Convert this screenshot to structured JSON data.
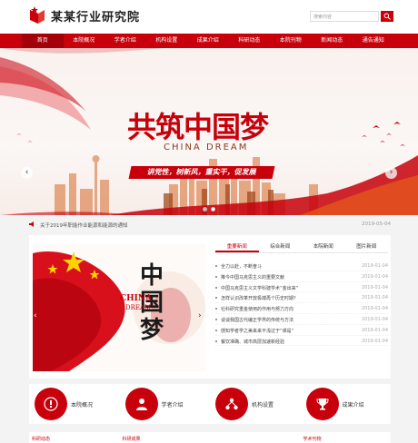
{
  "site": {
    "name": "某某行业研究院"
  },
  "search": {
    "placeholder": "搜索内容",
    "button_icon": "search-icon"
  },
  "nav": {
    "items": [
      "首页",
      "本院概况",
      "学者介绍",
      "机构设置",
      "成果介绍",
      "科研动态",
      "本院刊物",
      "新闻动态",
      "通告通知"
    ]
  },
  "banner": {
    "title": "共筑中国梦",
    "subtitle": "CHINA DREAM",
    "slogan": "讲党性，树新风，重实干，促发展",
    "dot_count": 2,
    "active_dot": 2
  },
  "notice": {
    "text": "关于2019年职能作业能源和能源的通知",
    "date": "2019-05-04"
  },
  "news": {
    "tabs": [
      "重要新闻",
      "综合新闻",
      "本院新闻",
      "图片新闻"
    ],
    "active_tab": 0,
    "slide_text": {
      "china": "CHINA",
      "dream": "DREAM",
      "chars": "中国梦"
    },
    "items": [
      {
        "title": "全力以赴，不断奋斗",
        "date": "2019-01-04"
      },
      {
        "title": "推今中国马克思主义的重要文献",
        "date": "2019-01-04"
      },
      {
        "title": "中国马克思主义文学科建学术“金出来”",
        "date": "2019-01-04"
      },
      {
        "title": "怎样认识改革开放极端再个历史时期？",
        "date": "2019-01-04"
      },
      {
        "title": "社科研究重金使用的作用与努力方向",
        "date": "2019-01-04"
      },
      {
        "title": "谈谈我国古代编正学界的传统与方法",
        "date": "2019-01-04"
      },
      {
        "title": "感知学者学之美来来不浅过于“课是”",
        "date": "2019-01-04"
      },
      {
        "title": "餐饮准确、城市高层加速新经验",
        "date": "2019-01-04"
      }
    ]
  },
  "features": [
    {
      "label": "本院概况",
      "icon": "building-icon"
    },
    {
      "label": "学者介绍",
      "icon": "person-icon"
    },
    {
      "label": "机构设置",
      "icon": "org-icon"
    },
    {
      "label": "成果介绍",
      "icon": "trophy-icon"
    }
  ],
  "bottom": {
    "labels": [
      "科研动态",
      "科研成果",
      "",
      "学术刊物"
    ]
  },
  "colors": {
    "brand": "#c7000b",
    "nav_active": "#a30009"
  }
}
